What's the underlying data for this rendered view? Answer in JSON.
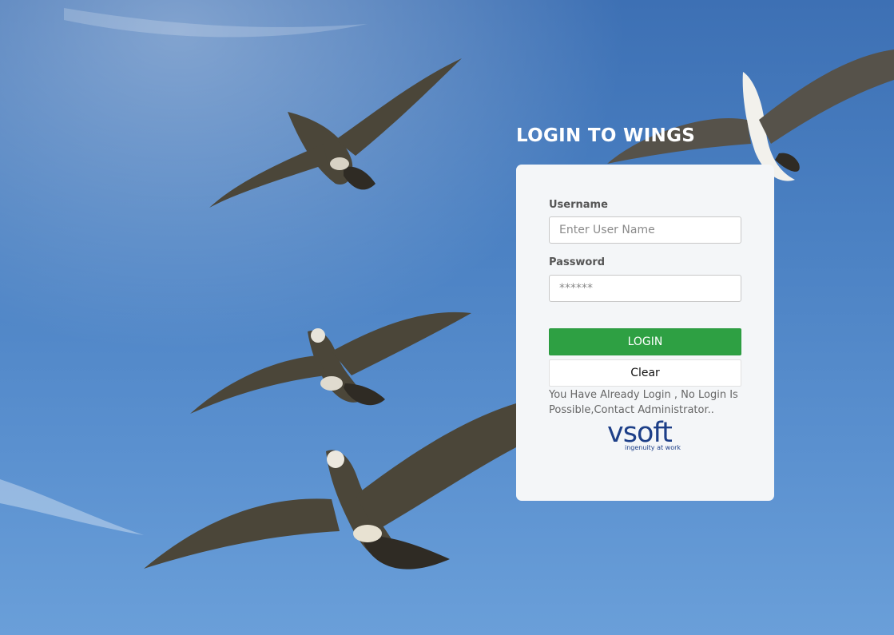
{
  "login": {
    "title": "LOGIN TO WINGS",
    "username_label": "Username",
    "username_placeholder": "Enter User Name",
    "username_value": "",
    "password_label": "Password",
    "password_placeholder": "******",
    "password_value": "",
    "login_button": "LOGIN",
    "clear_button": "Clear",
    "message": "You Have Already Login , No Login Is Possible,Contact Administrator.."
  },
  "logo": {
    "word": "vsoft",
    "tagline": "ingenuity at work"
  },
  "colors": {
    "accent": "#2ea043",
    "brand": "#1d3f88",
    "sky": "#4a80c2"
  }
}
